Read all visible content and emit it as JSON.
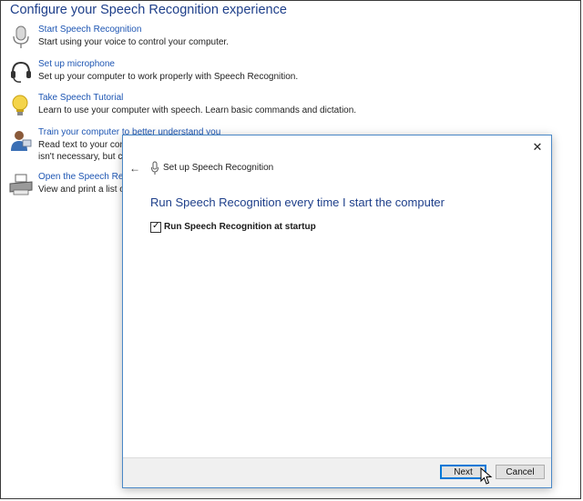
{
  "background": {
    "title": "Configure your Speech Recognition experience",
    "tasks": [
      {
        "icon": "microphone-icon",
        "link": "Start Speech Recognition",
        "desc": [
          "Start using your voice to control your computer."
        ]
      },
      {
        "icon": "headset-icon",
        "link": "Set up microphone",
        "desc": [
          "Set up your computer to work properly with Speech Recognition."
        ]
      },
      {
        "icon": "lightbulb-icon",
        "link": "Take Speech Tutorial",
        "desc": [
          "Learn to use your computer with speech.  Learn basic commands and dictation."
        ]
      },
      {
        "icon": "person-icon",
        "link": "Train your computer to better understand you",
        "desc": [
          "Read text to your comp",
          "isn't necessary, but can"
        ]
      },
      {
        "icon": "printer-icon",
        "link": "Open the Speech Refer",
        "desc": [
          "View and print a list of"
        ]
      }
    ]
  },
  "dialog": {
    "title": "Set up Speech Recognition",
    "heading": "Run Speech Recognition every time I start the computer",
    "checkbox_label": "Run Speech Recognition at startup",
    "checkbox_checked": true,
    "close_glyph": "✕",
    "back_glyph": "←",
    "check_glyph": "✓",
    "buttons": {
      "next": "Next",
      "cancel": "Cancel"
    }
  }
}
